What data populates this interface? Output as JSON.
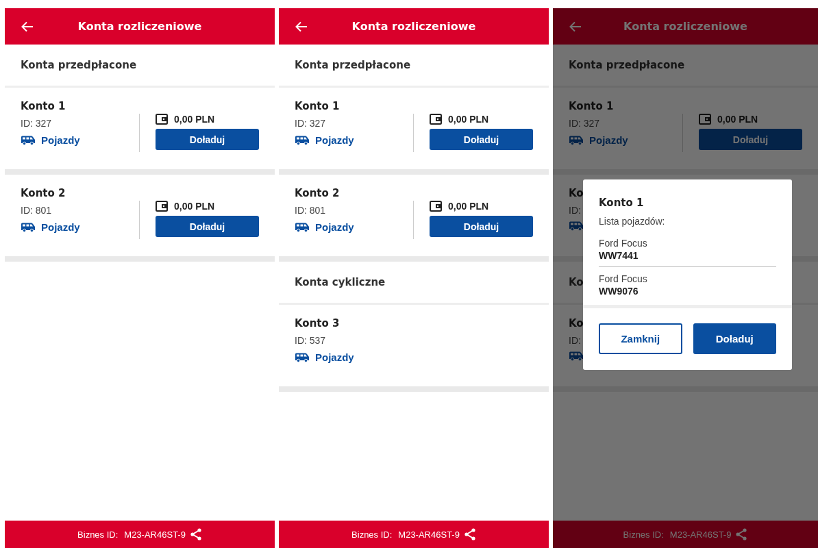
{
  "screens": [
    {
      "header": {
        "title": "Konta rozliczeniowe"
      },
      "dimmed": false,
      "sections": [
        {
          "title": "Konta przedpłacone",
          "accounts": [
            {
              "name": "Konto 1",
              "id": "ID: 327",
              "vehicles_link": "Pojazdy",
              "balance": "0,00 PLN",
              "topup_button": "Doładuj"
            },
            {
              "name": "Konto 2",
              "id": "ID: 801",
              "vehicles_link": "Pojazdy",
              "balance": "0,00 PLN",
              "topup_button": "Doładuj"
            }
          ]
        }
      ],
      "footer": {
        "label": "Biznes ID:",
        "value": "M23-AR46ST-9"
      }
    },
    {
      "header": {
        "title": "Konta rozliczeniowe"
      },
      "dimmed": false,
      "sections": [
        {
          "title": "Konta przedpłacone",
          "accounts": [
            {
              "name": "Konto 1",
              "id": "ID: 327",
              "vehicles_link": "Pojazdy",
              "balance": "0,00 PLN",
              "topup_button": "Doładuj"
            },
            {
              "name": "Konto 2",
              "id": "ID: 801",
              "vehicles_link": "Pojazdy",
              "balance": "0,00 PLN",
              "topup_button": "Doładuj"
            }
          ]
        },
        {
          "title": "Konta cykliczne",
          "accounts": [
            {
              "name": "Konto 3",
              "id": "ID: 537",
              "vehicles_link": "Pojazdy"
            }
          ]
        }
      ],
      "footer": {
        "label": "Biznes ID:",
        "value": "M23-AR46ST-9"
      }
    },
    {
      "header": {
        "title": "Konta rozliczeniowe"
      },
      "dimmed": true,
      "sections": [
        {
          "title": "Konta przedpłacone",
          "accounts": [
            {
              "name": "Konto 1",
              "id": "ID: 327",
              "vehicles_link": "Pojazdy",
              "balance": "0,00 PLN",
              "topup_button": "Doładuj"
            },
            {
              "name": "Ko",
              "id": "ID:"
            }
          ]
        },
        {
          "title": "Ko",
          "accounts": [
            {
              "name": "Ko",
              "id": "ID:"
            }
          ]
        }
      ],
      "footer": {
        "label": "Biznes ID:",
        "value": "M23-AR46ST-9"
      },
      "dialog": {
        "title": "Konto 1",
        "subtitle": "Lista pojazdów:",
        "vehicles": [
          {
            "model": "Ford Focus",
            "plate": "WW7441"
          },
          {
            "model": "Ford Focus",
            "plate": "WW9076"
          }
        ],
        "buttons": [
          {
            "label": "Zamknij",
            "kind": "secondary"
          },
          {
            "label": "Doładuj",
            "kind": "primary"
          }
        ]
      }
    }
  ]
}
